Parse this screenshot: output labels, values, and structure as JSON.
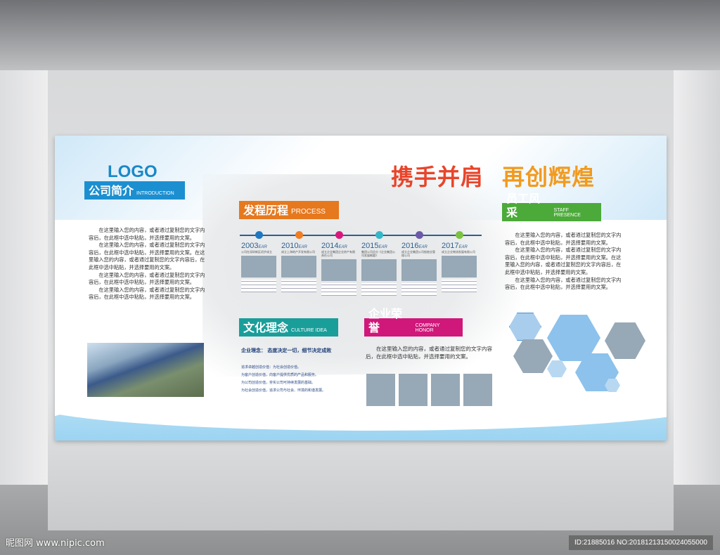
{
  "logo": "LOGO",
  "slogan": {
    "part1": "携手并肩",
    "part2": "再创辉煌"
  },
  "intro": {
    "title": "公司简介",
    "subtitle": "INTRODUCTION",
    "color": "#1c8fd0",
    "paragraphs": [
      "在这里输入您的内容，或者通过复制您的文字内容后，在此框中选中粘贴，并选择要用的文案。",
      "在这里输入您的内容，或者通过复制您的文字内容后，在此框中选中粘贴，并选择要用的文案。在这里输入您的内容，或者通过复制您的文字内容后，在此框中选中粘贴，并选择要用的文案。",
      "在这里输入您的内容，或者通过复制您的文字内容后，在此框中选中粘贴，并选择要用的文案。",
      "在这里输入您的内容，或者通过复制您的文字内容后，在此框中选中粘贴，并选择要用的文案。"
    ]
  },
  "process": {
    "title": "发程历程",
    "subtitle": "PROCESS",
    "color": "#e6781e",
    "items": [
      {
        "year": "2003",
        "suffix": "EAR",
        "color": "#1f78c1",
        "caption": "公司在深圳新区初步成立"
      },
      {
        "year": "2010",
        "suffix": "EAR",
        "color": "#ef7d22",
        "caption": "成立上海地产开发有限公司"
      },
      {
        "year": "2014",
        "suffix": "EAR",
        "color": "#d7197c",
        "caption": "成立企业集团企业房产有限责任公司"
      },
      {
        "year": "2015",
        "suffix": "EAR",
        "color": "#36b6c9",
        "caption": "集团公司总分《企业集团公司发展概要》"
      },
      {
        "year": "2016",
        "suffix": "EAR",
        "color": "#6b5aa8",
        "caption": "成立企业集团公司船舶业管理公司"
      },
      {
        "year": "2017",
        "suffix": "EAR",
        "color": "#7cc242",
        "caption": "成立企业物流发展有限公司"
      }
    ]
  },
  "staff": {
    "title": "员工风采",
    "subtitle": "STAFF PRESENCE",
    "color": "#4caa3a",
    "paragraphs": [
      "在这里输入您的内容，或者通过复制您的文字内容后，在此框中选中粘贴，并选择要用的文案。",
      "在这里输入您的内容，或者通过复制您的文字内容后，在此框中选中粘贴，并选择要用的文案。在这里输入您的内容，或者通过复制您的文字内容后，在此框中选中粘贴，并选择要用的文案。",
      "在这里输入您的内容，或者通过复制您的文字内容后，在此框中选中粘贴，并选择要用的文案。"
    ]
  },
  "culture": {
    "title": "文化理念",
    "subtitle": "CULTURE  IDEA",
    "color": "#1a9e9a",
    "motto": "企业理念：  态度决定一切，细节决定成败",
    "lines": [
      "追求卓越创造价值：为社会创造价值。",
      "为客户创造价值，向客户提供优质的产品和服务。",
      "为公司创造价值，夯实公司可持续发展的基础。",
      "为社会创造价值，追求公司与社会、环境的和谐发展。"
    ]
  },
  "honor": {
    "title": "企业荣誉",
    "subtitle": "COMPANY  HONOR",
    "color": "#d0177a",
    "paragraph": "在这里输入您的内容，或者通过复制您的文字内容后，在此框中选中粘贴，并选择要用的文案。"
  },
  "watermark": {
    "site": "昵图网 www.nipic.com",
    "id": "ID:21885016 NO:20181213150024055000"
  }
}
